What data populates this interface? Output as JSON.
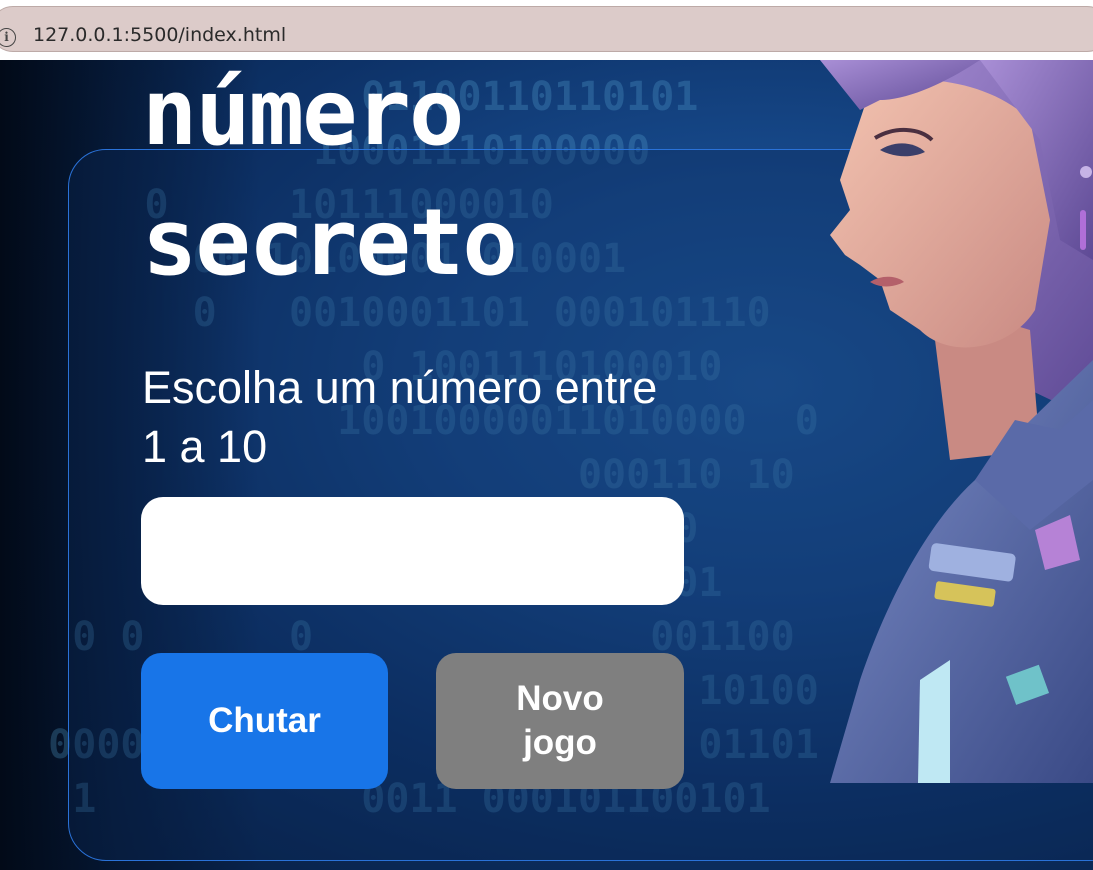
{
  "browser": {
    "url": "127.0.0.1:5500/index.html",
    "info_icon": "info-icon"
  },
  "binary_rows": [
    "               01100110110101",
    "             10001110100000",
    "      0     10111000010",
    "        00 10100001 010001",
    "        0   0010001101 000101110",
    "               0 1001110100010",
    "              10010000011010000  0",
    "                        000110 10",
    "                   0 01011100",
    "            110001 11001 00001",
    "   0 0      0              001100",
    "                  0          10100",
    "  00000110   10        00000 01101 0001",
    "   1           0011 000101100101"
  ],
  "game": {
    "title_line1": "número",
    "title_line2": "secreto",
    "prompt": "Escolha um número entre 1 a 10",
    "input_value": "",
    "guess_button": "Chutar",
    "new_game_button": "Novo jogo"
  },
  "colors": {
    "primary_button": "#1875e8",
    "secondary_button": "#7f7f7f",
    "card_border": "#2a72d8"
  }
}
